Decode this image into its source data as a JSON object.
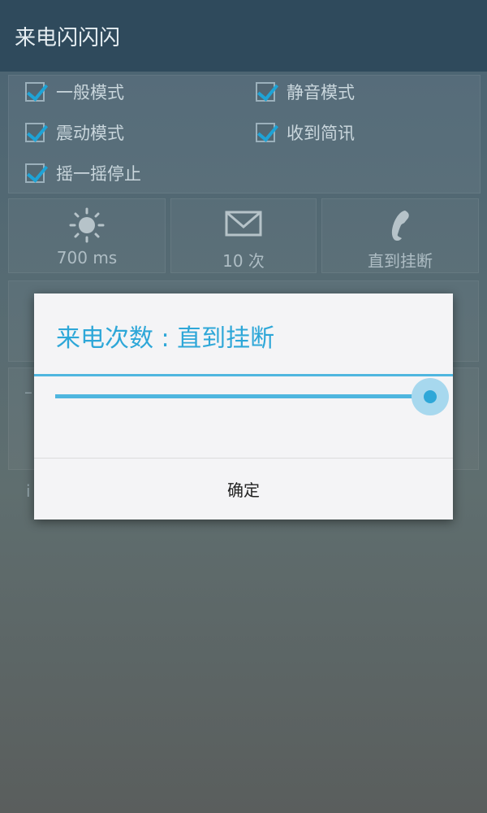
{
  "app": {
    "title": "来电闪闪闪"
  },
  "options": [
    {
      "label": "一般模式",
      "checked": true
    },
    {
      "label": "静音模式",
      "checked": true
    },
    {
      "label": "震动模式",
      "checked": true
    },
    {
      "label": "收到简讯",
      "checked": true
    },
    {
      "label": "摇一摇停止",
      "checked": true
    }
  ],
  "tiles": [
    {
      "icon": "sun-icon",
      "value": "700 ms"
    },
    {
      "icon": "mail-icon",
      "value": "10 次"
    },
    {
      "icon": "phone-icon",
      "value": "直到挂断"
    }
  ],
  "background": {
    "partial_row_label": "–",
    "partial_row2_label": "i"
  },
  "dialog": {
    "title": "来电次数 : 直到挂断",
    "slider_value_fraction": 1.0,
    "ok_label": "确定"
  },
  "colors": {
    "accent": "#2ea7d8",
    "actionbar": "#2f4a5c"
  }
}
